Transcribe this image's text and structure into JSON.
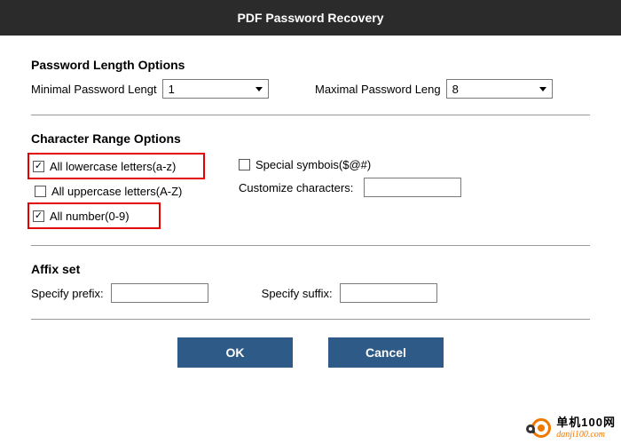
{
  "title": "PDF Password Recovery",
  "length": {
    "section_title": "Password Length Options",
    "min_label": "Minimal Password Lengt",
    "min_value": "1",
    "max_label": "Maximal Password Leng",
    "max_value": "8"
  },
  "charRange": {
    "section_title": "Character Range Options",
    "lowercase": {
      "label": "All lowercase letters(a-z)",
      "checked": true
    },
    "uppercase": {
      "label": "All uppercase letters(A-Z)",
      "checked": false
    },
    "numbers": {
      "label": "All number(0-9)",
      "checked": true
    },
    "symbols": {
      "label": "Special symbois($@#)",
      "checked": false
    },
    "customize_label": "Customize characters:",
    "customize_value": ""
  },
  "affix": {
    "section_title": "Affix set",
    "prefix_label": "Specify prefix:",
    "prefix_value": "",
    "suffix_label": "Specify suffix:",
    "suffix_value": ""
  },
  "buttons": {
    "ok": "OK",
    "cancel": "Cancel"
  },
  "watermark": {
    "cn": "单机100网",
    "en": "danji100.com"
  }
}
